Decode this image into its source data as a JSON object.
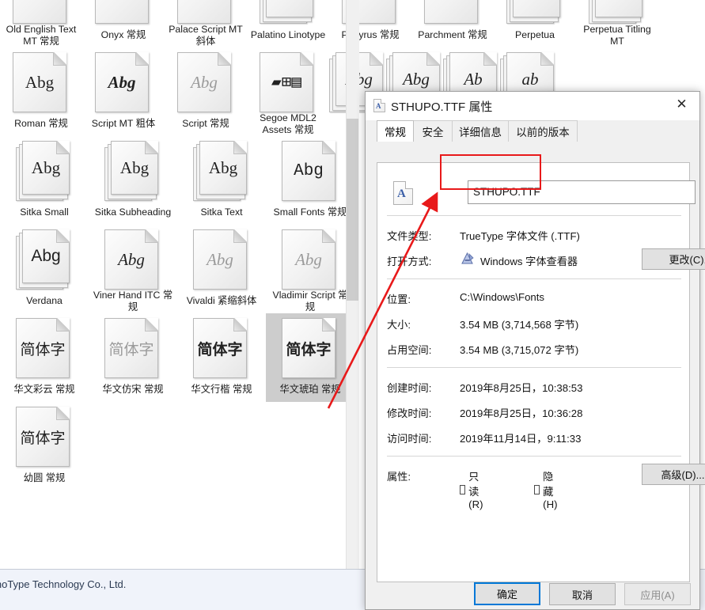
{
  "explorer": {
    "status_text": "hou SinoType Technology Co., Ltd.",
    "rows": [
      [
        {
          "label": "Old English Text MT 常规",
          "glyph": "",
          "style": "g-serif",
          "stacked": false,
          "clipped": true
        },
        {
          "label": "Onyx 常规",
          "glyph": "",
          "style": "g-serif",
          "stacked": false,
          "clipped": true
        },
        {
          "label": "Palace Script MT 斜体",
          "glyph": "",
          "style": "g-ital",
          "stacked": false,
          "clipped": true
        },
        {
          "label": "Palatino Linotype",
          "glyph": "",
          "style": "g-serif",
          "stacked": true,
          "clipped": true
        },
        {
          "label": "Papyrus 常规",
          "glyph": "",
          "style": "g-serif",
          "stacked": false,
          "clipped": true
        },
        {
          "label": "Parchment 常规",
          "glyph": "",
          "style": "g-ital",
          "stacked": false,
          "clipped": true
        },
        {
          "label": "Perpetua",
          "glyph": "",
          "style": "g-serif",
          "stacked": true,
          "clipped": true
        },
        {
          "label": "Perpetua Titling MT",
          "glyph": "",
          "style": "g-serif",
          "stacked": true,
          "clipped": true
        }
      ],
      [
        {
          "label": "Roman 常规",
          "glyph": "Abg",
          "style": "g-serif",
          "stacked": false
        },
        {
          "label": "Script MT 粗体",
          "glyph": "Abg",
          "style": "g-ital",
          "stacked": false,
          "bold": true
        },
        {
          "label": "Script 常规",
          "glyph": "Abg",
          "style": "g-ital",
          "stacked": false,
          "light": true
        },
        {
          "label": "Segoe MDL2 Assets 常规",
          "glyph": "▰⊞▤",
          "style": "g-mono",
          "stacked": false
        },
        {
          "label": "Abg",
          "glyph": "Abg",
          "style": "g-ital",
          "stacked": true,
          "hidden_label": true
        },
        {
          "label": "Abg",
          "glyph": "Abg",
          "style": "g-ital",
          "stacked": true,
          "hidden_label": true
        },
        {
          "label": "Ab",
          "glyph": "Ab",
          "style": "g-ital",
          "stacked": true,
          "hidden_label": true
        },
        {
          "label": "ab",
          "glyph": "ab",
          "style": "g-ital",
          "stacked": true,
          "hidden_label": true
        }
      ],
      [
        {
          "label": "Sitka Small",
          "glyph": "Abg",
          "style": "g-serif",
          "stacked": true
        },
        {
          "label": "Sitka Subheading",
          "glyph": "Abg",
          "style": "g-serif",
          "stacked": true
        },
        {
          "label": "Sitka Text",
          "glyph": "Abg",
          "style": "g-serif",
          "stacked": true
        },
        {
          "label": "Small Fonts 常规",
          "glyph": "Abg",
          "style": "g-mono",
          "stacked": false
        }
      ],
      [
        {
          "label": "Verdana",
          "glyph": "Abg",
          "style": "",
          "stacked": true
        },
        {
          "label": "Viner Hand ITC 常规",
          "glyph": "Abg",
          "style": "g-ital",
          "stacked": false
        },
        {
          "label": "Vivaldi 紧缩斜体",
          "glyph": "Abg",
          "style": "g-ital",
          "stacked": false,
          "light": true
        },
        {
          "label": "Vladimir Script 常规",
          "glyph": "Abg",
          "style": "g-ital",
          "stacked": false,
          "light": true
        }
      ],
      [
        {
          "label": "华文彩云 常规",
          "glyph": "简体字",
          "style": "g-cn",
          "stacked": false,
          "outline": true
        },
        {
          "label": "华文仿宋 常规",
          "glyph": "简体字",
          "style": "g-cn",
          "stacked": false,
          "light": true
        },
        {
          "label": "华文行楷 常规",
          "glyph": "简体字",
          "style": "g-cn",
          "stacked": false,
          "bold": true
        },
        {
          "label": "华文琥珀 常规",
          "glyph": "简体字",
          "style": "g-cn",
          "stacked": false,
          "bold": true,
          "selected": true
        }
      ],
      [
        {
          "label": "幼圆 常规",
          "glyph": "简体字",
          "style": "g-cn",
          "stacked": false
        }
      ]
    ]
  },
  "dialog": {
    "title": "STHUPO.TTF 属性",
    "title_icon": "font-file-icon",
    "close_icon": "✕",
    "tabs": [
      {
        "label": "常规",
        "active": true
      },
      {
        "label": "安全",
        "active": false
      },
      {
        "label": "详细信息",
        "active": false
      },
      {
        "label": "以前的版本",
        "active": false
      }
    ],
    "filename_value": "STHUPO.TTF",
    "properties": [
      {
        "label": "文件类型:",
        "value": "TrueType 字体文件 (.TTF)"
      },
      {
        "label": "打开方式:",
        "value": "Windows 字体查看器"
      },
      {
        "label": "位置:",
        "value": "C:\\Windows\\Fonts"
      },
      {
        "label": "大小:",
        "value": "3.54 MB (3,714,568 字节)"
      },
      {
        "label": "占用空间:",
        "value": "3.54 MB (3,715,072 字节)"
      },
      {
        "label": "创建时间:",
        "value": "2019年8月25日，10:38:53"
      },
      {
        "label": "修改时间:",
        "value": "2019年8月25日，10:36:28"
      },
      {
        "label": "访问时间:",
        "value": "2019年11月14日，9:11:33"
      }
    ],
    "change_button": "更改(C)...",
    "attributes_label": "属性:",
    "readonly_label": "只读(R)",
    "hidden_label": "隐藏(H)",
    "advanced_button": "高级(D)...",
    "ok_button": "确定",
    "cancel_button": "取消",
    "apply_button": "应用(A)",
    "accent_color": "#0078d7",
    "annotation_color": "#e8191a"
  }
}
